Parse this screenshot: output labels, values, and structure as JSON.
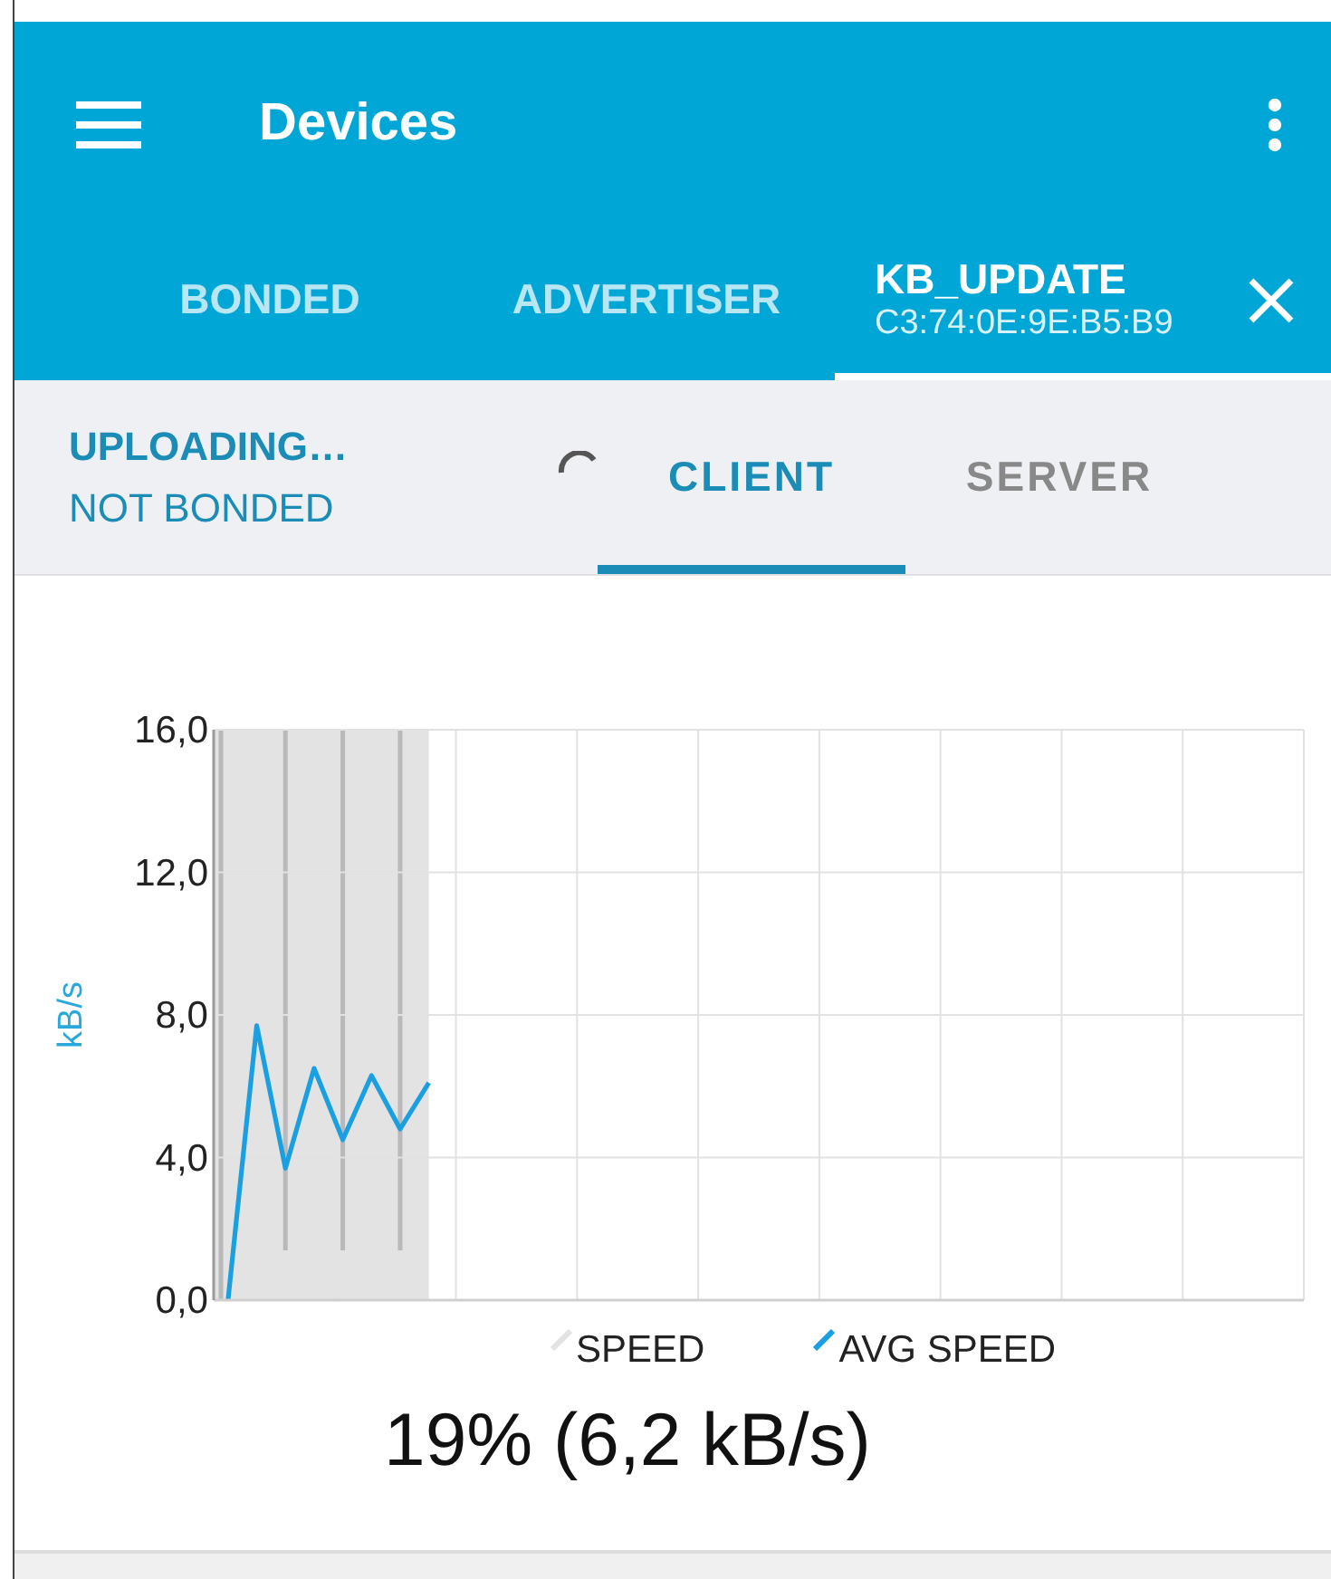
{
  "app_bar": {
    "title": "Devices"
  },
  "tabs": [
    {
      "label": "BONDED",
      "selected": false
    },
    {
      "label": "ADVERTISER",
      "selected": false
    },
    {
      "label": "KB_UPDATE",
      "subtitle": "C3:74:0E:9E:B5:B9",
      "selected": true
    }
  ],
  "status": {
    "state": "UPLOADING…",
    "bond": "NOT BONDED"
  },
  "sub_tabs": [
    {
      "label": "CLIENT",
      "selected": true
    },
    {
      "label": "SERVER",
      "selected": false
    }
  ],
  "chart": {
    "chart_data": {
      "type": "line",
      "ylabel": "kB/s",
      "ylim": [
        0,
        16
      ],
      "grid": true,
      "yticks": [
        {
          "value": 0,
          "label": "0,0"
        },
        {
          "value": 4,
          "label": "4,0"
        },
        {
          "value": 8,
          "label": "8,0"
        },
        {
          "value": 12,
          "label": "12,0"
        },
        {
          "value": 16,
          "label": "16,0"
        }
      ],
      "categories": [
        null,
        null,
        null,
        null,
        null,
        null,
        null,
        null,
        null,
        null,
        null,
        null,
        null,
        null,
        null,
        null,
        null,
        null,
        null,
        null,
        null,
        null,
        null,
        null,
        null,
        null,
        null,
        null,
        null,
        null,
        null,
        null,
        null,
        null,
        null,
        null,
        null,
        null
      ],
      "series": [
        {
          "name": "SPEED",
          "color": "#e3e3e4",
          "values": [
            null,
            null,
            null,
            null,
            null,
            null,
            null,
            null,
            null,
            null,
            null,
            null,
            null,
            null,
            null,
            null,
            null,
            null,
            null,
            null,
            null,
            null,
            null,
            null,
            null,
            null,
            null,
            null,
            null,
            null,
            null,
            null,
            null,
            null,
            null,
            null,
            null,
            null
          ]
        },
        {
          "name": "AVG SPEED",
          "color": "#1a9fe0",
          "values": [
            0,
            7.7,
            3.7,
            6.5,
            4.5,
            6.3,
            4.8,
            6.1,
            null,
            null,
            null,
            null,
            null,
            null,
            null,
            null,
            null,
            null,
            null,
            null,
            null,
            null,
            null,
            null,
            null,
            null,
            null,
            null,
            null,
            null,
            null,
            null,
            null,
            null,
            null,
            null,
            null,
            null
          ]
        }
      ]
    }
  },
  "progress_text": "19% (6,2 kB/s)"
}
